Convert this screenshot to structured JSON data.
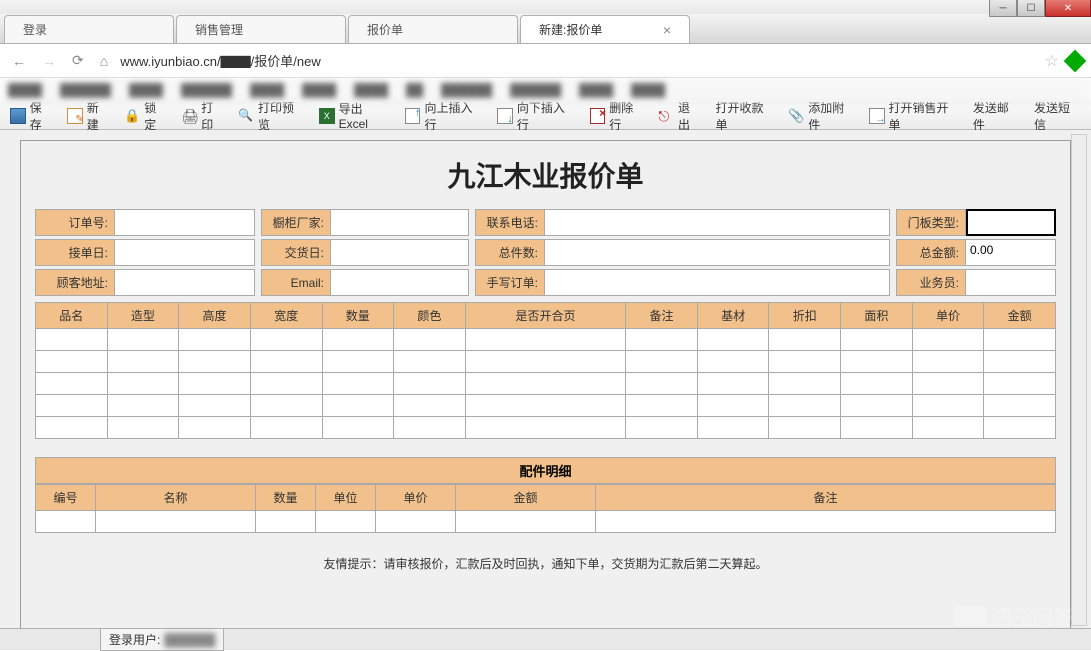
{
  "tabs": [
    {
      "label": "登录"
    },
    {
      "label": "销售管理"
    },
    {
      "label": "报价单"
    },
    {
      "label": "新建:报价单"
    }
  ],
  "address_bar": "www.iyunbiao.cn/▇▇▇/报价单/new",
  "toolbar": {
    "save": "保存",
    "new": "新建",
    "lock": "锁定",
    "print": "打印",
    "preview": "打印预览",
    "excel": "导出Excel",
    "insert_up": "向上插入行",
    "insert_down": "向下插入行",
    "delete_row": "删除行",
    "exit": "退出",
    "open_receipt": "打开收款单",
    "attach": "添加附件",
    "open_sales": "打开销售开单",
    "send_mail": "发送邮件",
    "send_sms": "发送短信"
  },
  "document_title": "九江木业报价单",
  "form": {
    "row1": {
      "order_no_lbl": "订单号:",
      "order_no": "",
      "cabinet_lbl": "橱柜厂家:",
      "cabinet": "",
      "phone_lbl": "联系电话:",
      "phone": "",
      "panel_lbl": "门板类型:",
      "panel": ""
    },
    "row2": {
      "recv_date_lbl": "接单日:",
      "recv_date": "",
      "deliver_date_lbl": "交货日:",
      "deliver_date": "",
      "total_qty_lbl": "总件数:",
      "total_qty": "",
      "total_amt_lbl": "总金额:",
      "total_amt": "0.00"
    },
    "row3": {
      "addr_lbl": "顾客地址:",
      "addr": "",
      "email_lbl": "Email:",
      "email": "",
      "handwrite_lbl": "手写订单:",
      "handwrite": "",
      "sales_lbl": "业务员:",
      "sales": ""
    }
  },
  "main_table_headers": [
    "品名",
    "造型",
    "高度",
    "宽度",
    "数量",
    "颜色",
    "是否开合页",
    "备注",
    "基材",
    "折扣",
    "面积",
    "单价",
    "金额"
  ],
  "main_table_rows": 5,
  "parts_section_title": "配件明细",
  "parts_table_headers": [
    "编号",
    "名称",
    "数量",
    "单位",
    "单价",
    "金额",
    "备注"
  ],
  "parts_table_rows": 1,
  "hint_text": "友情提示：请审核报价，汇款后及时回执，通知下单，交货期为汇款后第二天算起。",
  "status_label": "登录用户:",
  "watermark": "悟空问答"
}
